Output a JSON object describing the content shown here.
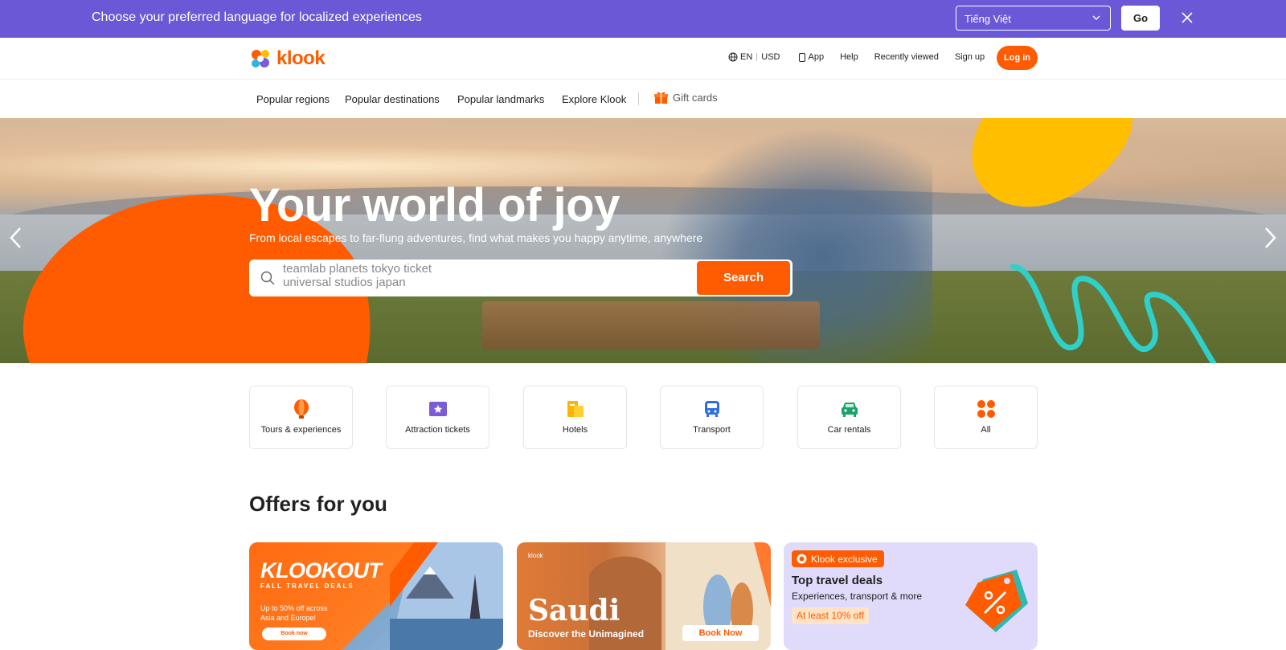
{
  "lang_banner": {
    "message": "Choose your preferred language for localized experiences",
    "selected_language": "Tiếng Việt",
    "go_label": "Go"
  },
  "header": {
    "logo_text": "klook",
    "language": "EN",
    "currency": "USD",
    "app_label": "App",
    "help_label": "Help",
    "recently_viewed_label": "Recently viewed",
    "signup_label": "Sign up",
    "login_label": "Log in"
  },
  "nav": {
    "items": [
      "Popular regions",
      "Popular destinations",
      "Popular landmarks",
      "Explore Klook"
    ],
    "gift_cards_label": "Gift cards"
  },
  "hero": {
    "title": "Your world of joy",
    "subtitle": "From local escapes to far-flung adventures, find what makes you happy anytime, anywhere",
    "search_suggestion_1": "teamlab planets tokyo ticket",
    "search_suggestion_2": "universal studios japan",
    "search_button": "Search"
  },
  "categories": [
    {
      "label": "Tours & experiences",
      "icon": "balloon-icon",
      "color": "#ff5b00"
    },
    {
      "label": "Attraction tickets",
      "icon": "ticket-icon",
      "color": "#7b5cd6"
    },
    {
      "label": "Hotels",
      "icon": "hotel-icon",
      "color": "#ffb400"
    },
    {
      "label": "Transport",
      "icon": "bus-icon",
      "color": "#2e6fe0"
    },
    {
      "label": "Car rentals",
      "icon": "car-icon",
      "color": "#19a36b"
    },
    {
      "label": "All",
      "icon": "grid-icon",
      "color": "#ff5b00"
    }
  ],
  "offers": {
    "title": "Offers for you",
    "cards": [
      {
        "brand": "KLOOKOUT",
        "tagline": "FALL TRAVEL DEALS",
        "detail": "Up to 50% off across Asia and Europe!",
        "button": "Book now"
      },
      {
        "logo_text": "klook",
        "title": "Saudi",
        "tagline": "Discover the Unimagined",
        "button": "Book Now"
      },
      {
        "badge": "Klook exclusive",
        "title": "Top travel deals",
        "subtitle": "Experiences, transport & more",
        "discount": "At least 10% off"
      }
    ]
  },
  "colors": {
    "accent": "#ff5b00",
    "banner": "#6a58d6",
    "offer_purple": "#e0dbfb"
  }
}
